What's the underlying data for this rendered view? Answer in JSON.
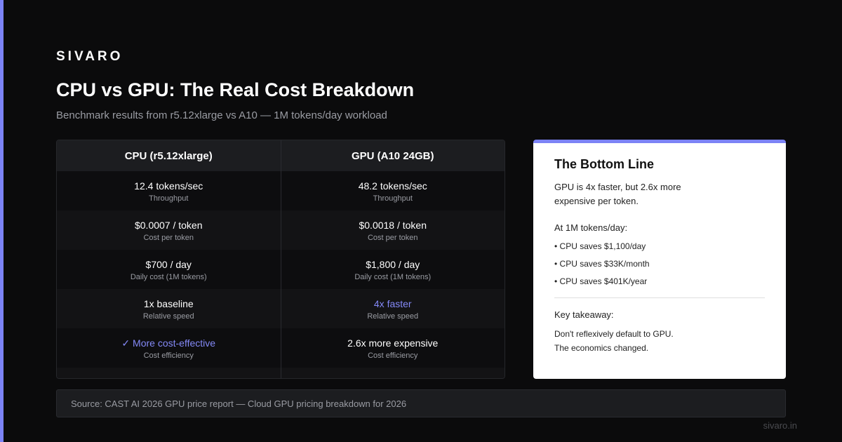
{
  "brand": "SIVARO",
  "title": "CPU vs GPU: The Real Cost Breakdown",
  "subtitle": "Benchmark results from r5.12xlarge vs A10 — 1M tokens/day workload",
  "colors": {
    "accent": "#7c83f5",
    "background": "#0b0b0c",
    "card": "#ffffff"
  },
  "table": {
    "cpu": {
      "header": "CPU (r5.12xlarge)",
      "rows": [
        {
          "value": "12.4 tokens/sec",
          "label": "Throughput"
        },
        {
          "value": "$0.0007 / token",
          "label": "Cost per token"
        },
        {
          "value": "$700 / day",
          "label": "Daily cost (1M tokens)"
        },
        {
          "value": "1x baseline",
          "label": "Relative speed"
        },
        {
          "value": "✓ More cost-effective",
          "label": "Cost efficiency"
        }
      ]
    },
    "gpu": {
      "header": "GPU (A10 24GB)",
      "rows": [
        {
          "value": "48.2 tokens/sec",
          "label": "Throughput"
        },
        {
          "value": "$0.0018 / token",
          "label": "Cost per token"
        },
        {
          "value": "$1,800 / day",
          "label": "Daily cost (1M tokens)"
        },
        {
          "value": "4x faster",
          "label": "Relative speed"
        },
        {
          "value": "2.6x more expensive",
          "label": "Cost efficiency"
        }
      ]
    }
  },
  "bottom_line": {
    "title": "The Bottom Line",
    "summary": "GPU is 4x faster, but 2.6x more expensive per token.",
    "at_label": "At 1M tokens/day:",
    "bullets": [
      "CPU saves $1,100/day",
      "CPU saves $33K/month",
      "CPU saves $401K/year"
    ],
    "takeaway_label": "Key takeaway:",
    "takeaway_line1": "Don't reflexively default to GPU.",
    "takeaway_line2": "The economics changed."
  },
  "source": "Source: CAST AI 2026 GPU price report — Cloud GPU pricing breakdown for 2026",
  "footer_url": "sivaro.in"
}
